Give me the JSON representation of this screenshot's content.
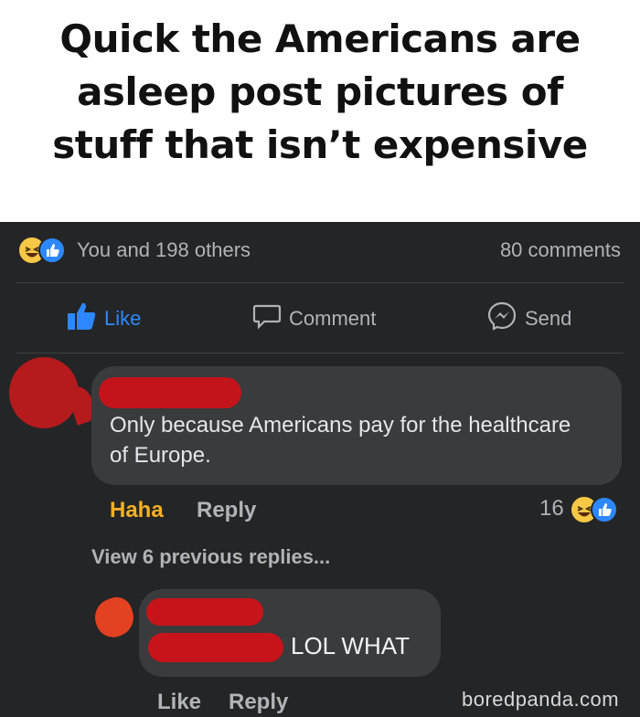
{
  "caption": {
    "lines": [
      "Quick the Americans are",
      "asleep post pictures of",
      "stuff that isn’t expensive"
    ]
  },
  "post": {
    "reactions_text": "You and 198 others",
    "comments_count": "80 comments",
    "actions": {
      "like": "Like",
      "comment": "Comment",
      "send": "Send"
    }
  },
  "comment1": {
    "text": "Only because Americans pay for the healthcare of Europe.",
    "reaction_label": "Haha",
    "reply_label": "Reply",
    "reaction_count": "16"
  },
  "view_previous": "View 6 previous replies...",
  "comment2": {
    "text": "LOL WHAT",
    "like_label": "Like",
    "reply_label": "Reply"
  },
  "watermark": "boredpanda.com",
  "colors": {
    "background": "#242526",
    "bubble": "#3a3b3c",
    "accent_blue": "#2d88ff",
    "haha_orange": "#f7b125",
    "redaction_red": "#c3141b"
  },
  "icons": [
    "haha-emoji-icon",
    "like-reaction-icon",
    "thumbs-up-icon",
    "comment-icon",
    "messenger-icon"
  ]
}
